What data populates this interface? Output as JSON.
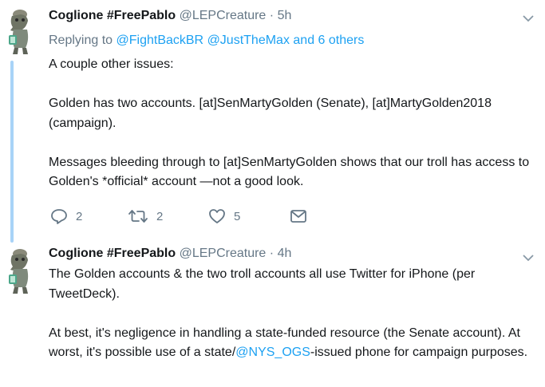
{
  "tweets": [
    {
      "author_name": "Coglione #FreePablo",
      "author_handle": "@LEPCreature",
      "separator": "·",
      "time": "5h",
      "replying_prefix": "Replying to",
      "replying_user_1": "@FightBackBR",
      "replying_user_2": "@JustTheMax",
      "replying_suffix": "and 6 others",
      "line1": "A couple other issues:",
      "line2": "Golden has two accounts. [at]SenMartyGolden (Senate), [at]MartyGolden2018 (campaign).",
      "line3": "Messages bleeding through to [at]SenMartyGolden shows that our troll has access to Golden's *official* account —not a good look.",
      "reply_count": "2",
      "retweet_count": "2",
      "like_count": "5"
    },
    {
      "author_name": "Coglione #FreePablo",
      "author_handle": "@LEPCreature",
      "separator": "·",
      "time": "4h",
      "line1": "The Golden accounts & the two troll accounts all use Twitter for iPhone (per TweetDeck).",
      "line2a": "At best, it's negligence in handling a state-funded resource (the Senate account). At worst, it's possible use of a state/",
      "mention": "@NYS_OGS",
      "line2b": "-issued phone for campaign purposes."
    }
  ],
  "icons": {
    "reply": "reply-icon",
    "retweet": "retweet-icon",
    "like": "heart-icon",
    "dm": "envelope-icon",
    "caret": "chevron-down-icon"
  },
  "colors": {
    "link": "#1da1f2",
    "secondary_text": "#657786",
    "thread_line": "#a8d3f7"
  }
}
